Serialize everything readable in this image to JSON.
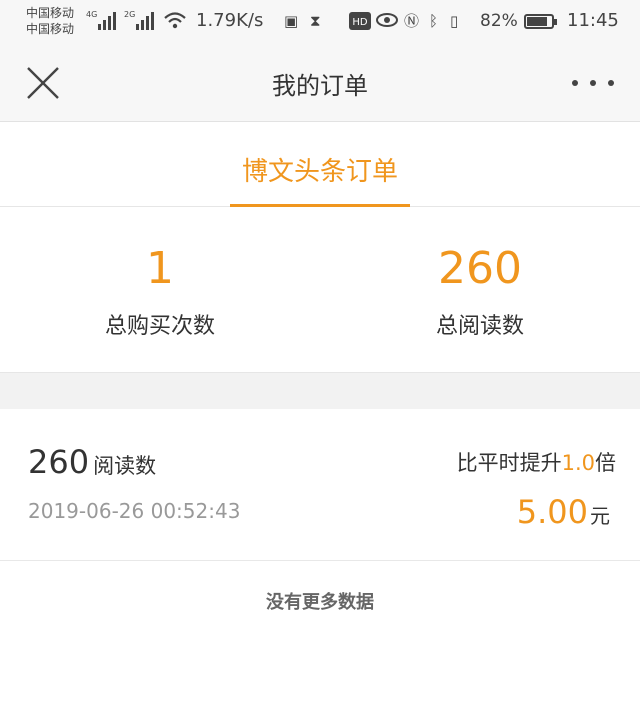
{
  "status_bar": {
    "carrier_1": "中国移动",
    "carrier_2": "中国移动",
    "network_1": "4G",
    "network_2": "2G",
    "speed": "1.79K/s",
    "battery_percent": "82%",
    "battery_level": 0.82,
    "time": "11:45"
  },
  "nav": {
    "title": "我的订单"
  },
  "tabs": [
    {
      "label": "博文头条订单"
    }
  ],
  "summary": {
    "purchase_count": "1",
    "purchase_label": "总购买次数",
    "read_count": "260",
    "read_label": "总阅读数"
  },
  "orders": [
    {
      "reads": "260",
      "reads_unit": "阅读数",
      "time": "2019-06-26 00:52:43",
      "boost_prefix": "比平时提升",
      "boost_value": "1.0",
      "boost_suffix": "倍",
      "price": "5.00",
      "price_unit": "元"
    }
  ],
  "footer": {
    "no_more": "没有更多数据"
  },
  "colors": {
    "accent": "#f0961e",
    "background": "#f2f2f2"
  }
}
